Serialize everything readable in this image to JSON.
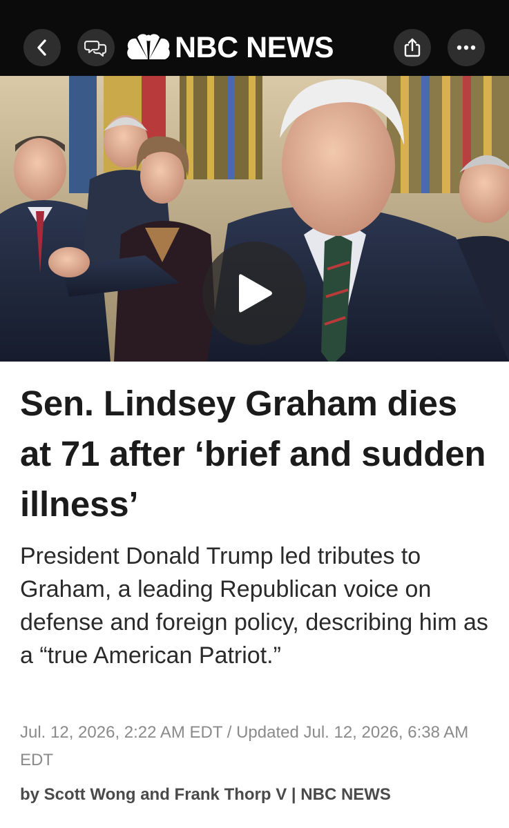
{
  "header": {
    "brand": "NBC NEWS",
    "icons": {
      "back": "chevron-left-icon",
      "ai": "ai-summary-icon",
      "share": "share-icon",
      "more": "more-icon"
    },
    "background": "#0b0b0b"
  },
  "video": {
    "play_icon": "play-icon",
    "description": "video thumbnail with play button"
  },
  "article": {
    "headline": "Sen. Lindsey Graham dies at 71 after ‘brief and sudden illness’",
    "dek": "President Donald Trump led tributes to Graham, a leading Republican voice on defense and foreign policy, describing him as a “true American Patriot.”",
    "timestamp": "Jul. 12, 2026, 2:22 AM EDT / Updated Jul. 12, 2026, 6:38 AM EDT",
    "byline": "by Scott Wong and Frank Thorp V | NBC NEWS"
  }
}
